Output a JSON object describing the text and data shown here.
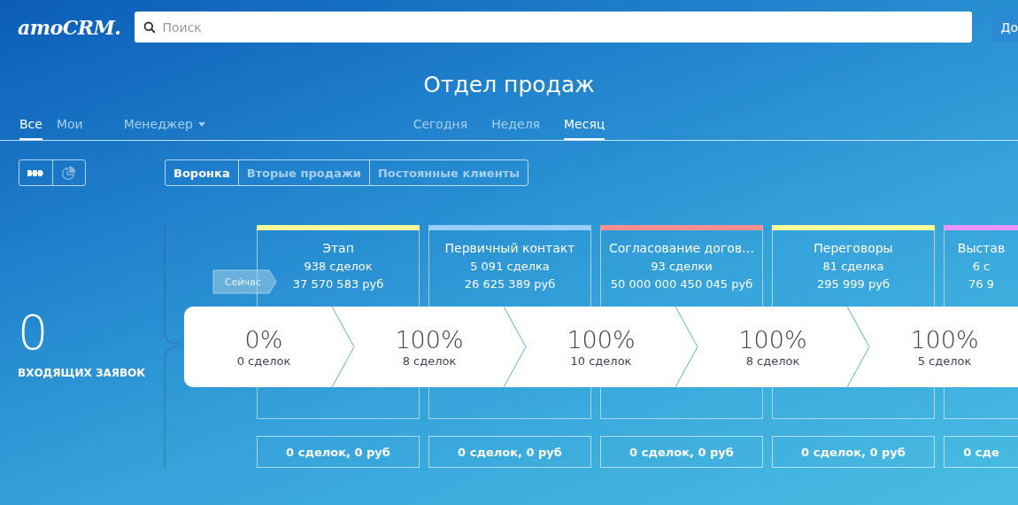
{
  "logo": "amoCRM.",
  "search": {
    "placeholder": "Поиск"
  },
  "header_button": {
    "label": "До"
  },
  "title": "Отдел продаж",
  "owner_tabs": [
    {
      "label": "Все",
      "selected": true
    },
    {
      "label": "Мои",
      "selected": false
    },
    {
      "label": "Менеджер",
      "selected": false,
      "dropdown": true
    }
  ],
  "period_tabs": [
    {
      "label": "Сегодня",
      "selected": false
    },
    {
      "label": "Неделя",
      "selected": false
    },
    {
      "label": "Месяц",
      "selected": true
    }
  ],
  "view_toggle": [
    {
      "kind": "funnel",
      "selected": true
    },
    {
      "kind": "pie",
      "selected": false
    }
  ],
  "pipeline_tabs": [
    {
      "label": "Воронка",
      "selected": true
    },
    {
      "label": "Вторые продажи",
      "selected": false
    },
    {
      "label": "Постоянные клиенты",
      "selected": false
    }
  ],
  "incoming": {
    "count": "0",
    "label": "ВХОДЯЩИХ ЗАЯВОК"
  },
  "now_tag": "Сейчас",
  "stages": [
    {
      "name": "Этап",
      "deals": "938 сделок",
      "sum": "37 570 583 руб",
      "color": "#f9f99a",
      "footer": "0 сделок, 0 руб"
    },
    {
      "name": "Первичный контакт",
      "deals": "5 091 сделка",
      "sum": "26 625 389 руб",
      "color": "#99ccff",
      "footer": "0 сделок, 0 руб"
    },
    {
      "name": "Согласование догов…",
      "deals": "93 сделки",
      "sum": "50 000 000 450 045 руб",
      "color": "#ff8f92",
      "footer": "0 сделок, 0 руб"
    },
    {
      "name": "Переговоры",
      "deals": "81 сделка",
      "sum": "295 999 руб",
      "color": "#ffff99",
      "footer": "0 сделок, 0 руб"
    },
    {
      "name": "Выстав",
      "deals": "6 с",
      "sum": "76 9",
      "color": "#eb93ff",
      "footer": "0 сде"
    }
  ],
  "funnel": [
    {
      "percent": "0%",
      "deals": "0 сделок"
    },
    {
      "percent": "100%",
      "deals": "8 сделок"
    },
    {
      "percent": "100%",
      "deals": "10 сделок"
    },
    {
      "percent": "100%",
      "deals": "8 сделок"
    },
    {
      "percent": "100%",
      "deals": "5 сделок"
    }
  ]
}
